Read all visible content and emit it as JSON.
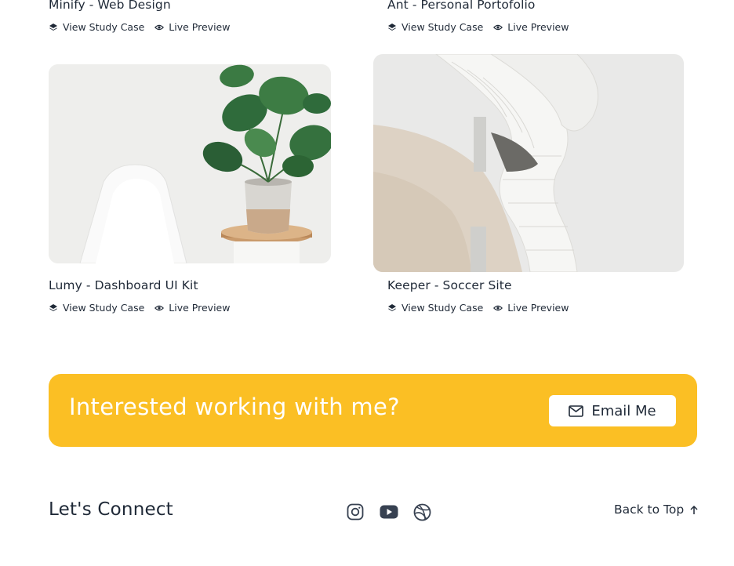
{
  "projects": [
    {
      "title": "Minify - Web Design",
      "study_label": "View Study Case",
      "preview_label": "Live Preview"
    },
    {
      "title": "Ant - Personal Portofolio",
      "study_label": "View Study Case",
      "preview_label": "Live Preview"
    },
    {
      "title": "Lumy - Dashboard UI Kit",
      "study_label": "View Study Case",
      "preview_label": "Live Preview",
      "image": "plant-and-chair-photo"
    },
    {
      "title": "Keeper - Soccer Site",
      "study_label": "View Study Case",
      "preview_label": "Live Preview",
      "image": "curved-building-photo"
    }
  ],
  "cta": {
    "heading": "Interested working with me?",
    "button_label": "Email Me",
    "background": "#FBBF24"
  },
  "footer": {
    "title": "Let's Connect",
    "social": [
      "instagram-icon",
      "youtube-icon",
      "dribbble-icon"
    ],
    "back_to_top": "Back to Top"
  }
}
